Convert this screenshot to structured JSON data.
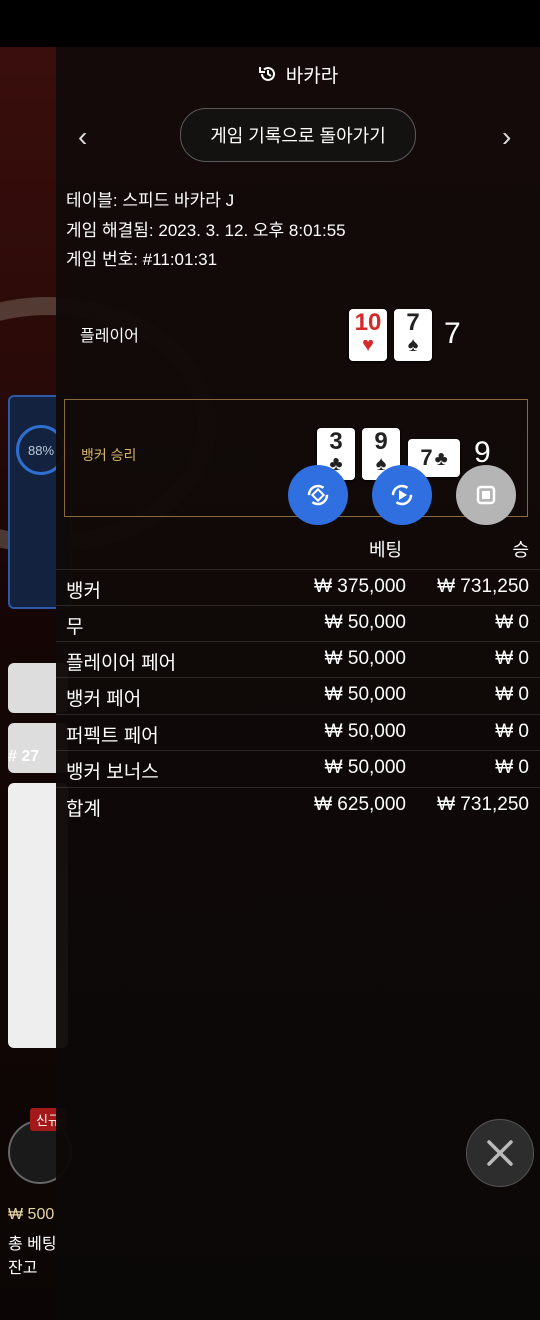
{
  "background": {
    "progress_pct": "88%",
    "round_no": "# 27",
    "new_badge": "신규",
    "lines": [
      "₩ 500",
      "총 베팅",
      "잔고"
    ]
  },
  "header": {
    "title": "바카라",
    "back_label": "게임 기록으로 돌아가기"
  },
  "info": {
    "table": "테이블: 스피드 바카라 J",
    "resolved": "게임 해결됨: 2023. 3. 12. 오후 8:01:55",
    "game_no": "게임 번호: #11:01:31"
  },
  "player": {
    "label": "플레이어",
    "cards": [
      {
        "rank": "10",
        "suit": "♥",
        "color": "red"
      },
      {
        "rank": "7",
        "suit": "♠",
        "color": "black"
      }
    ],
    "score": "7"
  },
  "banker": {
    "label": "뱅커 승리",
    "cards": [
      {
        "rank": "3",
        "suit": "♣",
        "color": "black"
      },
      {
        "rank": "9",
        "suit": "♠",
        "color": "black"
      },
      {
        "rank": "7",
        "suit": "♣",
        "color": "black"
      }
    ],
    "score": "9"
  },
  "bets_table": {
    "headers": {
      "bet": "베팅",
      "win": "승"
    },
    "rows": [
      {
        "label": "뱅커",
        "bet": "₩ 375,000",
        "win": "₩ 731,250"
      },
      {
        "label": "무",
        "bet": "₩ 50,000",
        "win": "₩ 0"
      },
      {
        "label": "플레이어 페어",
        "bet": "₩ 50,000",
        "win": "₩ 0"
      },
      {
        "label": "뱅커 페어",
        "bet": "₩ 50,000",
        "win": "₩ 0"
      },
      {
        "label": "퍼펙트 페어",
        "bet": "₩ 50,000",
        "win": "₩ 0"
      },
      {
        "label": "뱅커 보너스",
        "bet": "₩ 50,000",
        "win": "₩ 0"
      },
      {
        "label": "합계",
        "bet": "₩ 625,000",
        "win": "₩ 731,250"
      }
    ]
  },
  "colors": {
    "accent_blue": "#2f6fe0",
    "gold_border": "#8a6a3a",
    "gold_text": "#d6b56a"
  }
}
